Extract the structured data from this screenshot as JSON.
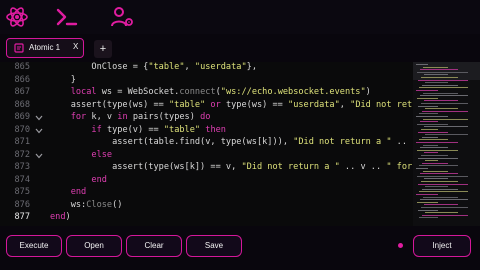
{
  "app": {
    "accent_color": "#d4179a"
  },
  "toolbar": {
    "icons": [
      "atom-icon",
      "terminal-icon",
      "user-settings-icon"
    ]
  },
  "tabs": [
    {
      "label": "Atomic 1",
      "close_label": "X",
      "icon": "code-file-icon"
    }
  ],
  "add_tab_label": "+",
  "editor": {
    "active_line": "877",
    "lines": [
      {
        "num": "865",
        "fold": false
      },
      {
        "num": "866",
        "fold": false
      },
      {
        "num": "867",
        "fold": false
      },
      {
        "num": "868",
        "fold": false
      },
      {
        "num": "869",
        "fold": true
      },
      {
        "num": "870",
        "fold": true
      },
      {
        "num": "871",
        "fold": false
      },
      {
        "num": "872",
        "fold": true
      },
      {
        "num": "873",
        "fold": false
      },
      {
        "num": "874",
        "fold": false
      },
      {
        "num": "875",
        "fold": false
      },
      {
        "num": "876",
        "fold": false
      },
      {
        "num": "877",
        "fold": false
      }
    ],
    "code": [
      [
        {
          "t": "        OnClose = {",
          "c": ""
        },
        {
          "t": "\"table\"",
          "c": "s"
        },
        {
          "t": ", ",
          "c": ""
        },
        {
          "t": "\"userdata\"",
          "c": "s"
        },
        {
          "t": "},",
          "c": ""
        }
      ],
      [
        {
          "t": "    }",
          "c": ""
        }
      ],
      [
        {
          "t": "    ",
          "c": ""
        },
        {
          "t": "local",
          "c": "k"
        },
        {
          "t": " ws = WebSocket.",
          "c": ""
        },
        {
          "t": "connect",
          "c": "f"
        },
        {
          "t": "(",
          "c": ""
        },
        {
          "t": "\"ws://echo.websocket.events\"",
          "c": "s"
        },
        {
          "t": ")",
          "c": ""
        }
      ],
      [
        {
          "t": "    assert(type(ws) == ",
          "c": ""
        },
        {
          "t": "\"table\"",
          "c": "s"
        },
        {
          "t": " ",
          "c": ""
        },
        {
          "t": "or",
          "c": "k"
        },
        {
          "t": " type(ws) == ",
          "c": ""
        },
        {
          "t": "\"userdata\"",
          "c": "s"
        },
        {
          "t": ", ",
          "c": ""
        },
        {
          "t": "\"Did not return a \"",
          "c": "s"
        },
        {
          "t": " o",
          "c": ""
        }
      ],
      [
        {
          "t": "    ",
          "c": ""
        },
        {
          "t": "for",
          "c": "k"
        },
        {
          "t": " k, v ",
          "c": ""
        },
        {
          "t": "in",
          "c": "k"
        },
        {
          "t": " pairs(types) ",
          "c": ""
        },
        {
          "t": "do",
          "c": "k"
        }
      ],
      [
        {
          "t": "        ",
          "c": ""
        },
        {
          "t": "if",
          "c": "k"
        },
        {
          "t": " type(v) == ",
          "c": ""
        },
        {
          "t": "\"table\"",
          "c": "s"
        },
        {
          "t": " ",
          "c": ""
        },
        {
          "t": "then",
          "c": "k"
        }
      ],
      [
        {
          "t": "            assert(table.find(v, type(ws[k])), ",
          "c": ""
        },
        {
          "t": "\"Did not return a \"",
          "c": "s"
        },
        {
          "t": " .. table.concat(",
          "c": ""
        }
      ],
      [
        {
          "t": "        ",
          "c": ""
        },
        {
          "t": "else",
          "c": "k"
        }
      ],
      [
        {
          "t": "            assert(type(ws[k]) == v, ",
          "c": ""
        },
        {
          "t": "\"Did not return a \"",
          "c": "s"
        },
        {
          "t": " .. v .. ",
          "c": ""
        },
        {
          "t": "\" for \"",
          "c": "s"
        },
        {
          "t": " .. k",
          "c": ""
        }
      ],
      [
        {
          "t": "        ",
          "c": ""
        },
        {
          "t": "end",
          "c": "k"
        }
      ],
      [
        {
          "t": "    ",
          "c": ""
        },
        {
          "t": "end",
          "c": "k"
        }
      ],
      [
        {
          "t": "    ws:",
          "c": ""
        },
        {
          "t": "Close",
          "c": "f"
        },
        {
          "t": "()",
          "c": ""
        }
      ],
      [
        {
          "t": "end",
          "c": "k"
        },
        {
          "t": ")",
          "c": ""
        }
      ]
    ]
  },
  "buttons": {
    "execute": "Execute",
    "open": "Open",
    "clear": "Clear",
    "save": "Save",
    "inject": "Inject"
  }
}
